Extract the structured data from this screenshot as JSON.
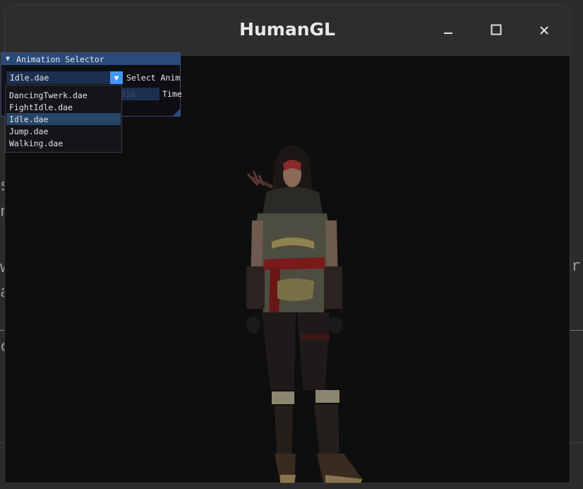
{
  "window": {
    "title": "HumanGL",
    "controls": {
      "minimize": "minimize-icon",
      "maximize": "maximize-icon",
      "close": "close-icon"
    }
  },
  "panel": {
    "title": "Animation Selector",
    "combo": {
      "selected": "Idle.dae",
      "label": "Select Anim"
    },
    "slider": {
      "value": "2.010",
      "label": "Time"
    },
    "dropdown_items": [
      {
        "label": "DancingTwerk.dae",
        "selected": false
      },
      {
        "label": "FightIdle.dae",
        "selected": false
      },
      {
        "label": "Idle.dae",
        "selected": true
      },
      {
        "label": "Jump.dae",
        "selected": false
      },
      {
        "label": "Walking.dae",
        "selected": false
      }
    ]
  },
  "colors": {
    "titlebar": "#2d2d2d",
    "viewport": "#0e0e0e",
    "imgui_header": "#294a7a",
    "imgui_frame": "#1d2f4f",
    "imgui_button": "#4296fa",
    "imgui_selected": "#264569"
  }
}
